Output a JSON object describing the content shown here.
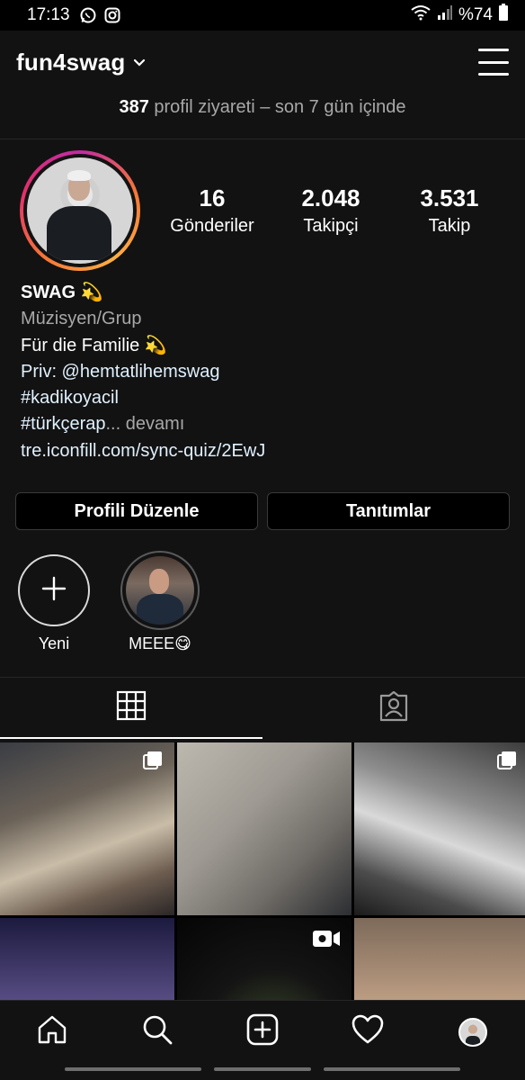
{
  "status_bar": {
    "time": "17:13",
    "battery": "%74",
    "icons": [
      "whatsapp-icon",
      "instagram-icon",
      "wifi-icon",
      "signal-icon",
      "battery-icon"
    ]
  },
  "header": {
    "username": "fun4swag"
  },
  "insights": {
    "count": "387",
    "text": "profil ziyareti – son 7 gün içinde"
  },
  "stats": [
    {
      "value": "16",
      "label": "Gönderiler"
    },
    {
      "value": "2.048",
      "label": "Takipçi"
    },
    {
      "value": "3.531",
      "label": "Takip"
    }
  ],
  "bio": {
    "name": "SWAG 💫",
    "category": "Müzisyen/Grup",
    "line1": "Für die Familie 💫",
    "line2": "Priv: @hemtatlihemswag",
    "line3": "#kadikoyacil",
    "line4_start": "#türkçerap",
    "line4_more": "... devamı",
    "link": "tre.iconfill.com/sync-quiz/2EwJ"
  },
  "buttons": {
    "edit_profile": "Profili Düzenle",
    "promotions": "Tanıtımlar"
  },
  "highlights": [
    {
      "label": "Yeni"
    },
    {
      "label": "MEEE😋"
    }
  ],
  "colors": {
    "background": "#121212",
    "text": "#ffffff",
    "secondary": "#a8a8a8",
    "link": "#e0f1ff"
  }
}
